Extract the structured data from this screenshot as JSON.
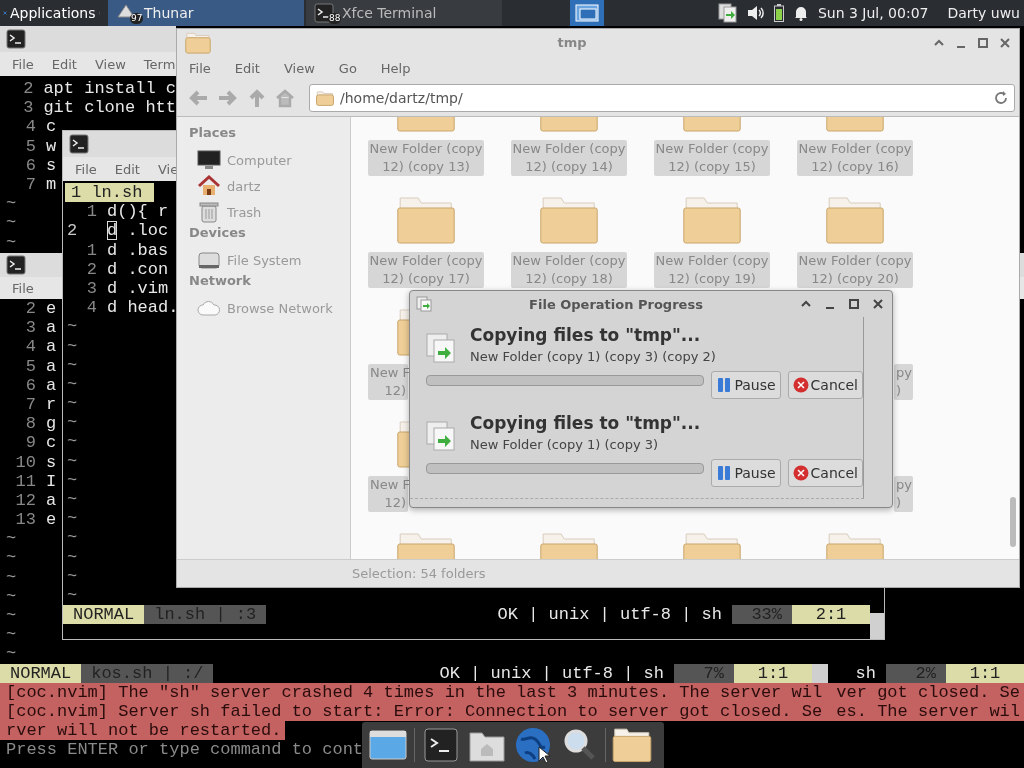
{
  "panel": {
    "applications": "Applications",
    "tasks": [
      {
        "label": "Thunar",
        "badge": "97",
        "selected": true
      },
      {
        "label": "Xfce Terminal",
        "badge": "88",
        "selected": false
      }
    ],
    "clock": "Sun  3 Jul, 00:07",
    "user": "Darty uwu"
  },
  "terminal_top": {
    "menu": [
      "File",
      "Edit",
      "View",
      "Term"
    ],
    "lines": [
      {
        "number": "2",
        "text": "apt install c"
      },
      {
        "number": "3",
        "text": "git clone htt"
      },
      {
        "number": "4",
        "text": "c"
      },
      {
        "number": "5",
        "text": "w"
      },
      {
        "number": "6",
        "text": "s"
      },
      {
        "number": "7",
        "text": "m"
      }
    ],
    "fillers": [
      "~",
      "~",
      "~"
    ]
  },
  "terminal_bottom": {
    "menu": [
      "File"
    ],
    "lines": [
      {
        "number": "2",
        "text": "e"
      },
      {
        "number": "3",
        "text": "a"
      },
      {
        "number": "4",
        "text": "a"
      },
      {
        "number": "5",
        "text": "a"
      },
      {
        "number": "6",
        "text": "a"
      },
      {
        "number": "7",
        "text": "r"
      },
      {
        "number": "8",
        "text": "g"
      },
      {
        "number": "9",
        "text": "c"
      },
      {
        "number": "10",
        "text": "s"
      },
      {
        "number": "11",
        "text": "I"
      },
      {
        "number": "12",
        "text": "a"
      },
      {
        "number": "13",
        "text": "e"
      }
    ],
    "fillers": [
      "~",
      "~",
      "~",
      "~",
      "~",
      "~",
      "~"
    ],
    "statusline": {
      "mode": "NORMAL",
      "file": "kos.sh | :/",
      "info": "OK | unix | utf-8 | sh",
      "percent": "7%",
      "position": "1:1"
    },
    "statusline_right": {
      "info": "sh",
      "percent": "2%",
      "position": "1:1"
    },
    "messages": [
      [
        "[coc.nvim] The \"sh\" server crashed 4 times in the last 3 minutes. The server wil",
        "ver got closed. Se"
      ],
      [
        "[coc.nvim] Server sh failed to start: Error: Connection to server got closed. Se",
        "es. The server wil"
      ],
      [
        "rver will not be restarted."
      ]
    ],
    "prompt": "Press ENTER or type command to cont"
  },
  "terminal_middle": {
    "menu": [
      "File",
      "Edit",
      "Vie"
    ],
    "tab": "1 ln.sh",
    "lines": [
      {
        "number": "1",
        "text": "d(){ r",
        "current": false
      },
      {
        "number": "2",
        "text": "d .loc",
        "current": true
      },
      {
        "number": "1",
        "text": "d .bas",
        "current": false
      },
      {
        "number": "2",
        "text": "d .con",
        "current": false
      },
      {
        "number": "3",
        "text": "d .vim",
        "current": false
      },
      {
        "number": "4",
        "text": "d head.",
        "current": false
      }
    ],
    "fillers": [
      "~",
      "~",
      "~",
      "~",
      "~",
      "~",
      "~",
      "~",
      "~",
      "~",
      "~",
      "~",
      "~",
      "~",
      "~"
    ],
    "statusline": {
      "mode": "NORMAL",
      "file": "ln.sh | :3",
      "info": "OK | unix | utf-8 | sh",
      "percent": "33%",
      "position": "2:1"
    }
  },
  "file_manager": {
    "title": "tmp",
    "menu": [
      "File",
      "Edit",
      "View",
      "Go",
      "Help"
    ],
    "location": "/home/dartz/tmp/",
    "sidebar": [
      {
        "heading": "Places",
        "items": [
          "Computer",
          "dartz",
          "Trash"
        ]
      },
      {
        "heading": "Devices",
        "items": [
          "File System"
        ]
      },
      {
        "heading": "Network",
        "items": [
          "Browse Network"
        ]
      }
    ],
    "rows": [
      [
        {
          "kind": "full",
          "selected": true,
          "label": [
            "New Folder (copy",
            "12) (copy 13)"
          ]
        },
        {
          "kind": "full",
          "selected": true,
          "label": [
            "New Folder (copy",
            "12) (copy 14)"
          ]
        },
        {
          "kind": "full",
          "selected": true,
          "label": [
            "New Folder (copy",
            "12) (copy 15)"
          ]
        },
        {
          "kind": "full",
          "selected": true,
          "label": [
            "New Folder (copy",
            "12) (copy 16)"
          ]
        }
      ],
      [
        {
          "kind": "full",
          "selected": true,
          "label": [
            "New Folder (copy",
            "12) (copy 17)"
          ]
        },
        {
          "kind": "full",
          "selected": true,
          "label": [
            "New Folder (copy",
            "12) (copy 18)"
          ]
        },
        {
          "kind": "full",
          "selected": true,
          "label": [
            "New Folder (copy",
            "12) (copy 19)"
          ]
        },
        {
          "kind": "full",
          "selected": true,
          "label": [
            "New Folder (copy",
            "12) (copy 20)"
          ]
        }
      ],
      [
        {
          "kind": "left_part",
          "selected": true,
          "label": [
            "New F",
            "12)"
          ]
        },
        {
          "kind": "right_part",
          "selected": true,
          "label": [
            "py",
            ")"
          ]
        }
      ],
      [
        {
          "kind": "left_part",
          "selected": true,
          "label": [
            "New F",
            "12)"
          ]
        },
        {
          "kind": "right_part",
          "selected": true,
          "label": [
            "py",
            ")"
          ]
        }
      ],
      [
        {
          "kind": "icon_only"
        },
        {
          "kind": "icon_only"
        },
        {
          "kind": "icon_only"
        },
        {
          "kind": "icon_only"
        }
      ]
    ],
    "status": "Selection: 54 folders"
  },
  "progress_dialog": {
    "title": "File Operation Progress",
    "operations": [
      {
        "title": "Copying files to \"tmp\"...",
        "file": "New Folder (copy 1) (copy 3) (copy 2)",
        "level": 0,
        "buttons": [
          "Pause",
          "Cancel"
        ]
      },
      {
        "title": "Copying files to \"tmp\"...",
        "file": "New Folder (copy 1) (copy 3)",
        "level": 0,
        "buttons": [
          "Pause",
          "Cancel"
        ]
      }
    ]
  }
}
